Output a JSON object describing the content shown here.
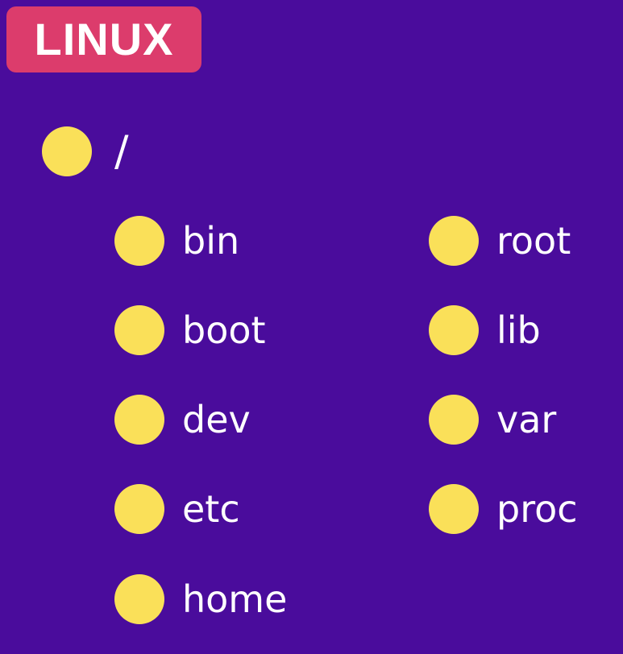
{
  "badge": {
    "label": "LINUX"
  },
  "root": {
    "label": "/"
  },
  "left_column": [
    {
      "label": "bin"
    },
    {
      "label": "boot"
    },
    {
      "label": "dev"
    },
    {
      "label": "etc"
    },
    {
      "label": "home"
    }
  ],
  "right_column": [
    {
      "label": "root"
    },
    {
      "label": "lib"
    },
    {
      "label": "var"
    },
    {
      "label": "proc"
    }
  ],
  "colors": {
    "background": "#4a0c9c",
    "badge": "#dc3c6c",
    "bullet": "#fae059",
    "text": "#ffffff"
  }
}
